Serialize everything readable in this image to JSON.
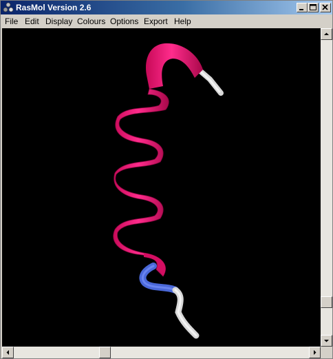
{
  "window": {
    "title": "RasMol Version 2.6",
    "app_icon": "molecule-icon",
    "controls": [
      "minimize-icon",
      "maximize-icon",
      "close-icon"
    ]
  },
  "menubar": {
    "items": [
      "File",
      "Edit",
      "Display",
      "Colours",
      "Options",
      "Export",
      "Help"
    ]
  },
  "viewport": {
    "background": "#000000",
    "structure": "protein helix (cartoon ribbon)",
    "colors": {
      "helix": "#f0106e",
      "coil_blue": "#4f6fe0",
      "coil_white": "#e8e8e8"
    }
  },
  "scrollbars": {
    "vertical": {
      "position": 0.85
    },
    "horizontal": {
      "position": 0.33
    }
  }
}
